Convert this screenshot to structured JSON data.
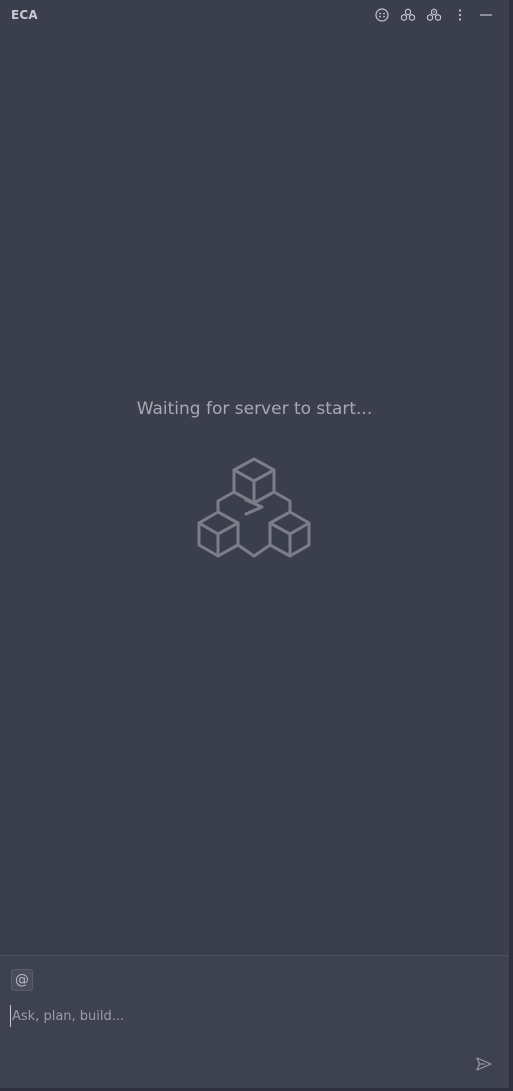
{
  "header": {
    "title": "ECA",
    "actions": [
      {
        "icon": "smiley-icon"
      },
      {
        "icon": "mcp-servers-icon"
      },
      {
        "icon": "mcp-servers-alt-icon"
      },
      {
        "icon": "more-vertical-icon"
      },
      {
        "icon": "minimize-icon"
      }
    ]
  },
  "main": {
    "status_text": "Waiting for server to start..."
  },
  "composer": {
    "context_label": "@",
    "placeholder": "Ask, plan, build..."
  },
  "colors": {
    "background": "#3b3e4c",
    "composer_background": "#3e4150",
    "logo_stroke": "#7b7e88"
  }
}
